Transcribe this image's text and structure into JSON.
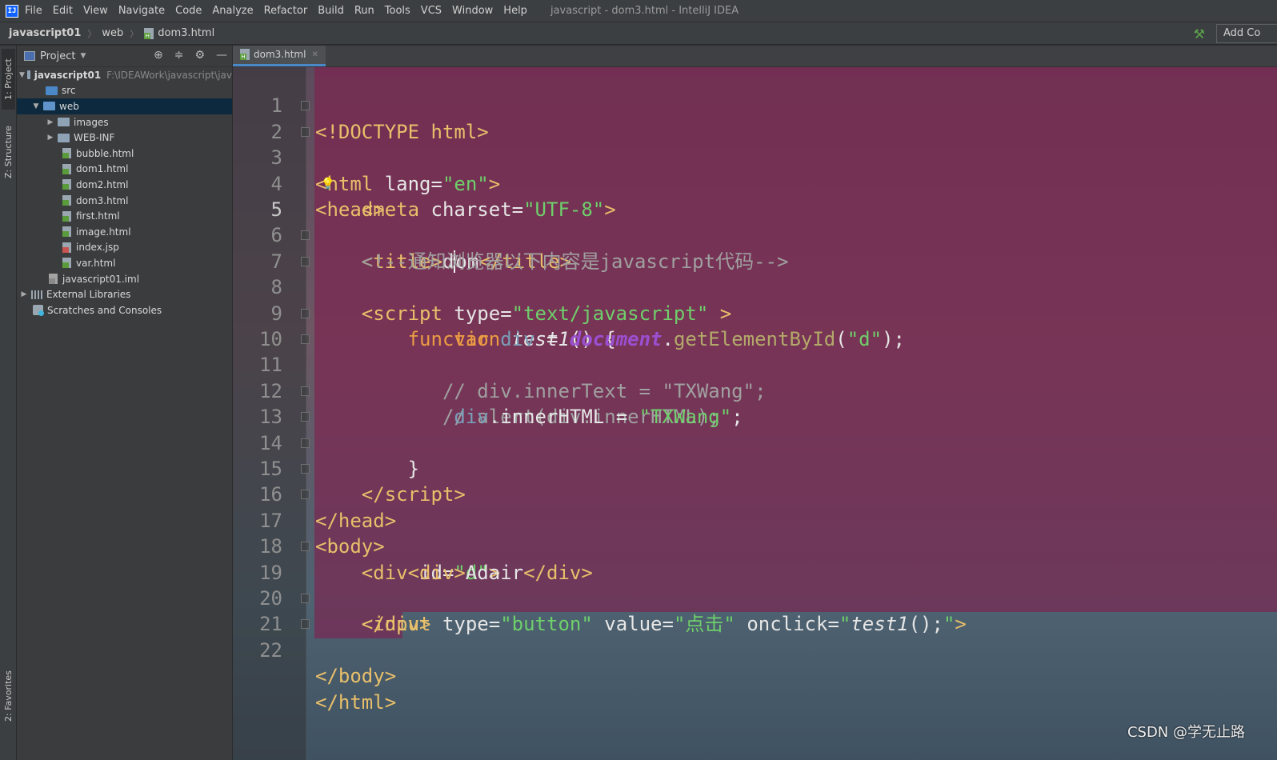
{
  "menubar": {
    "items": [
      "File",
      "Edit",
      "View",
      "Navigate",
      "Code",
      "Analyze",
      "Refactor",
      "Build",
      "Run",
      "Tools",
      "VCS",
      "Window",
      "Help"
    ],
    "window_title": "javascript - dom3.html - IntelliJ IDEA"
  },
  "navbar": {
    "breadcrumbs": [
      "javascript01",
      "web",
      "dom3.html"
    ],
    "add_config": "Add Co"
  },
  "toolstrip": {
    "project_tab": "1: Project",
    "structure_tab": "Z: Structure",
    "favorites_tab": "2: Favorites"
  },
  "project_panel": {
    "title": "Project",
    "root_name": "javascript01",
    "root_path": "F:\\IDEAWork\\javascript\\jav",
    "items": [
      "src",
      "web",
      "images",
      "WEB-INF",
      "bubble.html",
      "dom1.html",
      "dom2.html",
      "dom3.html",
      "first.html",
      "image.html",
      "index.jsp",
      "var.html",
      "javascript01.iml",
      "External Libraries",
      "Scratches and Consoles"
    ]
  },
  "editor": {
    "tab_label": "dom3.html",
    "line_numbers": [
      "1",
      "2",
      "3",
      "4",
      "5",
      "6",
      "7",
      "8",
      "9",
      "10",
      "11",
      "12",
      "13",
      "14",
      "15",
      "16",
      "17",
      "18",
      "19",
      "20",
      "21",
      "22"
    ],
    "current_line": "5"
  },
  "watermark": "CSDN @学无止路",
  "colors": {
    "selection_bg": "#801e4e",
    "tag": "#e8bf6a",
    "string": "#6fcf6b",
    "keyword": "#ec9c43",
    "comment": "#a0a0a0"
  }
}
